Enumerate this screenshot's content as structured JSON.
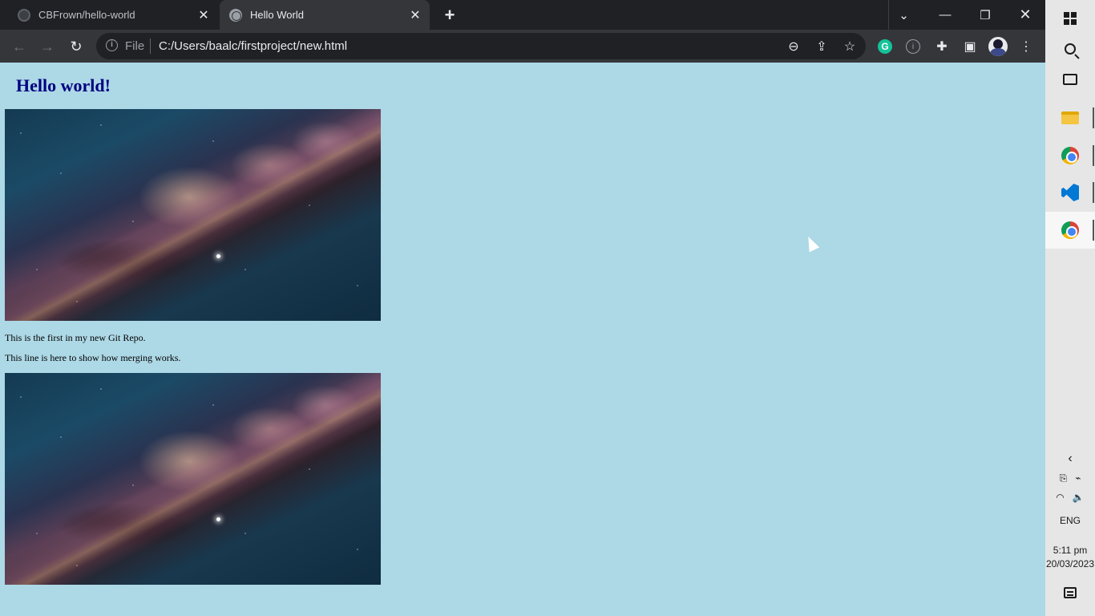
{
  "browser": {
    "tabs": [
      {
        "title": "CBFrown/hello-world",
        "active": false
      },
      {
        "title": "Hello World",
        "active": true
      }
    ],
    "omnibox": {
      "scheme_label": "File",
      "url": "C:/Users/baalc/firstproject/new.html"
    }
  },
  "page": {
    "heading": "Hello world!",
    "paragraphs": [
      "This is the first in my new Git Repo.",
      "This line is here to show how merging works."
    ],
    "background_color": "#add8e6",
    "heading_color": "#000080"
  },
  "taskbar": {
    "language": "ENG",
    "time": "5:11 pm",
    "date": "20/03/2023"
  }
}
